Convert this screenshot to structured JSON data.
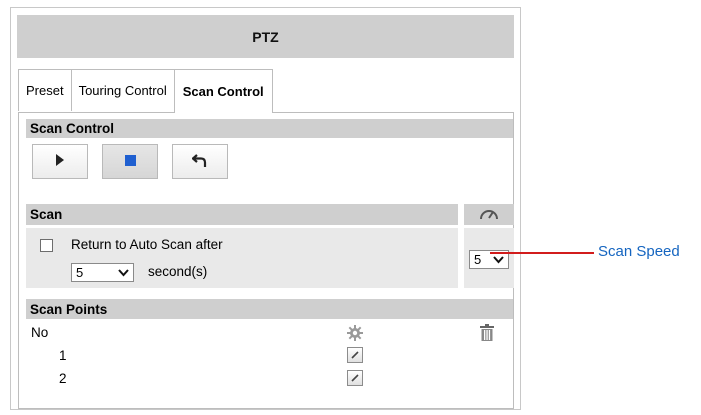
{
  "window": {
    "title": "PTZ"
  },
  "tabs": [
    {
      "label": "Preset",
      "active": false
    },
    {
      "label": "Touring Control",
      "active": false
    },
    {
      "label": "Scan Control",
      "active": true
    }
  ],
  "scan_control": {
    "header": "Scan Control",
    "buttons": [
      {
        "name": "play",
        "icon": "play-icon"
      },
      {
        "name": "stop",
        "icon": "stop-icon",
        "pressed": true
      },
      {
        "name": "return",
        "icon": "return-icon"
      }
    ]
  },
  "scan": {
    "header": "Scan",
    "speed_icon": "speedometer-icon",
    "auto_scan_label": "Return to Auto Scan after",
    "auto_scan_checked": false,
    "seconds_value": "5",
    "seconds_unit": "second(s)",
    "speed_value": "5"
  },
  "scan_points": {
    "header": "Scan Points",
    "columns": {
      "no": "No",
      "settings_icon": "gear-icon",
      "delete_icon": "trash-icon"
    },
    "rows": [
      {
        "no": "1",
        "action_icon": "edit-icon"
      },
      {
        "no": "2",
        "action_icon": "edit-icon"
      }
    ]
  },
  "annotation": {
    "label": "Scan Speed",
    "color": "#1565c0",
    "line_color": "#d21c1c"
  }
}
